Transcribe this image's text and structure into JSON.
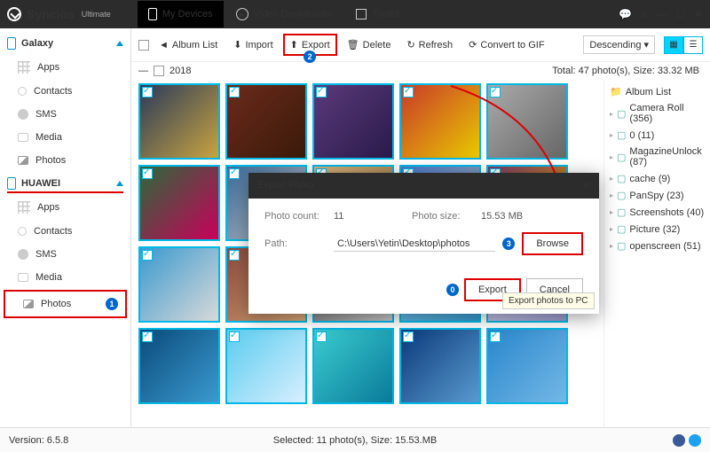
{
  "app": {
    "name": "Syncios",
    "edition": "Ultimate"
  },
  "nav": {
    "devices": "My Devices",
    "video": "Video Downloader",
    "toolkit": "Toolkit"
  },
  "devices": [
    {
      "name": "Galaxy",
      "items": [
        "Apps",
        "Contacts",
        "SMS",
        "Media",
        "Photos"
      ]
    },
    {
      "name": "HUAWEI",
      "items": [
        "Apps",
        "Contacts",
        "SMS",
        "Media",
        "Photos"
      ]
    }
  ],
  "toolbar": {
    "album": "Album List",
    "import": "Import",
    "export": "Export",
    "delete": "Delete",
    "refresh": "Refresh",
    "gif": "Convert to GIF",
    "sort": "Descending"
  },
  "year": "2018",
  "stats": "Total: 47 photo(s), Size: 33.32 MB",
  "albums": {
    "title": "Album List",
    "items": [
      "Camera Roll (356)",
      "0 (11)",
      "MagazineUnlock (87)",
      "cache (9)",
      "PanSpy (23)",
      "Screenshots (40)",
      "Picture (32)",
      "openscreen (51)"
    ]
  },
  "modal": {
    "title": "Export Photo",
    "count_lbl": "Photo count:",
    "count": "11",
    "size_lbl": "Photo size:",
    "size": "15.53 MB",
    "path_lbl": "Path:",
    "path": "C:\\Users\\Yetin\\Desktop\\photos",
    "browse": "Browse",
    "export": "Export",
    "cancel": "Cancel"
  },
  "tooltip": "Export photos to PC",
  "status": {
    "version": "Version: 6.5.8",
    "selected": "Selected: 11 photo(s), Size: 15.53.MB"
  },
  "thumbs": [
    "linear-gradient(135deg,#2a3a5a,#c9a340)",
    "linear-gradient(135deg,#6b2a1a,#3a1a0a)",
    "linear-gradient(135deg,#5a3a7a,#2a1a4a)",
    "linear-gradient(135deg,#c93a2a,#e8c800)",
    "linear-gradient(135deg,#aaa,#666)",
    "linear-gradient(135deg,#2a6a3a,#c9005a)",
    "linear-gradient(135deg,#3a6a9a,#c9c9c9)",
    "linear-gradient(135deg,#d9b380,#8a6a3a)",
    "linear-gradient(135deg,#4a7acf,#aaa)",
    "linear-gradient(135deg,#7a3a6a,#e8a800)",
    "linear-gradient(135deg,#3a9acf,#d9d9d9)",
    "linear-gradient(135deg,#8a4a3a,#d9a97a)",
    "linear-gradient(135deg,#5a5a5a,#c9c9c9)",
    "linear-gradient(135deg,#7accef,#3a9acf)",
    "linear-gradient(135deg,#d9d9ef,#9a9acf)",
    "linear-gradient(135deg,#0a4a7a,#3a9acf)",
    "linear-gradient(135deg,#5accef,#d9efff)",
    "linear-gradient(135deg,#3acccf,#0a7a9a)",
    "linear-gradient(135deg,#0a3a7a,#5a9acf)",
    "linear-gradient(135deg,#2986cc,#73b8e6)"
  ]
}
